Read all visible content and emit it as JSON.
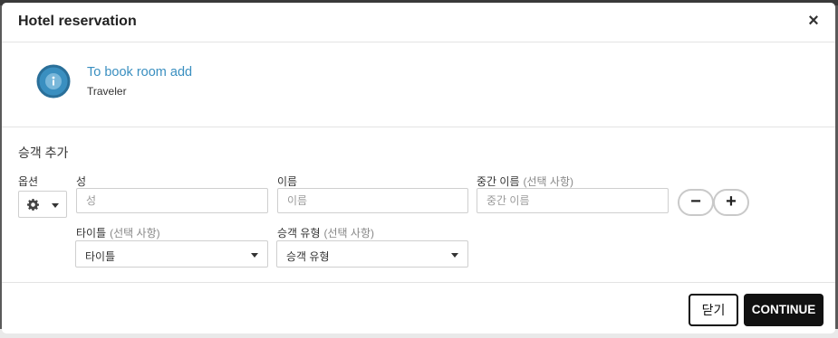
{
  "dialog": {
    "title": "Hotel reservation",
    "close_symbol": "×"
  },
  "info": {
    "icon": "info-icon",
    "title": "To book room add",
    "subtitle": "Traveler"
  },
  "form": {
    "section_title": "승객 추가",
    "options_label": "옵션",
    "options_icon": "gear-icon",
    "last_name": {
      "label": "성",
      "placeholder": "성",
      "value": ""
    },
    "first_name": {
      "label": "이름",
      "placeholder": "이름",
      "value": ""
    },
    "middle_name": {
      "label": "중간 이름",
      "optional": "(선택 사항)",
      "placeholder": "중간 이름",
      "value": ""
    },
    "title_select": {
      "label": "타이틀",
      "optional": "(선택 사항)",
      "value": "타이틀"
    },
    "passenger_type": {
      "label": "승객 유형",
      "optional": "(선택 사항)",
      "value": "승객 유형"
    },
    "remove_label": "−",
    "add_label": "+"
  },
  "footer": {
    "close_label": "닫기",
    "continue_label": "CONTINUE"
  },
  "colors": {
    "accent": "#3a8fc0",
    "primary_button": "#111111"
  }
}
